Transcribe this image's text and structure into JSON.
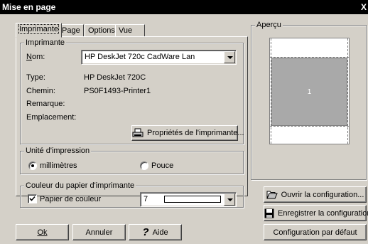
{
  "window": {
    "title": "Mise en page",
    "close_glyph": "X"
  },
  "tabs": [
    {
      "label": "Imprimante",
      "active": true
    },
    {
      "label": "Page"
    },
    {
      "label": "Options"
    },
    {
      "label": "Vue"
    }
  ],
  "printer_group": {
    "title": "Imprimante",
    "name_label": "Nom:",
    "name_value": "HP DeskJet 720c CadWare Lan",
    "type_label": "Type:",
    "type_value": "HP DeskJet 720C",
    "path_label": "Chemin:",
    "path_value": "PS0F1493-Printer1",
    "remark_label": "Remarque:",
    "location_label": "Emplacement:",
    "properties_button": "Propriétés de l'imprimante..."
  },
  "units_group": {
    "title": "Unité d'impression",
    "options": [
      {
        "label": "millimètres",
        "selected": true
      },
      {
        "label": "Pouce",
        "selected": false
      }
    ]
  },
  "paper_color_group": {
    "title": "Couleur du papier d'imprimante",
    "checkbox_label": "Papier de couleur",
    "checked": true,
    "color_value": "7",
    "color_swatch": "#ffffff"
  },
  "preview": {
    "title": "Aperçu",
    "page_number": "1"
  },
  "config_buttons": {
    "open": "Ouvrir la configuration...",
    "save": "Enregistrer la configuration...",
    "default": "Configuration par défaut"
  },
  "footer_buttons": {
    "ok": "Ok",
    "cancel": "Annuler",
    "help": "Aide"
  }
}
